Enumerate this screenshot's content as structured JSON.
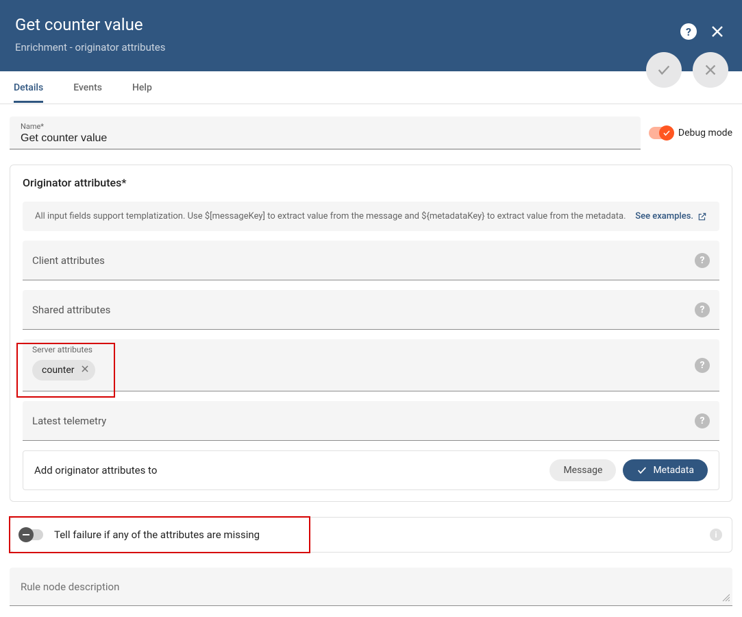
{
  "header": {
    "title": "Get counter value",
    "subtitle": "Enrichment - originator attributes"
  },
  "tabs": {
    "items": [
      "Details",
      "Events",
      "Help"
    ],
    "active": 0
  },
  "nameField": {
    "label": "Name*",
    "value": "Get counter value"
  },
  "debug": {
    "label": "Debug mode",
    "on": true
  },
  "panel": {
    "title": "Originator attributes*",
    "info": "All input fields support templatization. Use $[messageKey] to extract value from the message and ${metadataKey} to extract value from the metadata.",
    "seeExamples": "See examples.",
    "client": {
      "placeholder": "Client attributes"
    },
    "shared": {
      "placeholder": "Shared attributes"
    },
    "server": {
      "label": "Server attributes",
      "chips": [
        "counter"
      ]
    },
    "telemetry": {
      "placeholder": "Latest telemetry"
    },
    "dest": {
      "label": "Add originator attributes to",
      "options": {
        "message": "Message",
        "metadata": "Metadata"
      },
      "selected": "metadata"
    }
  },
  "failToggle": {
    "label": "Tell failure if any of the attributes are missing",
    "on": false
  },
  "description": {
    "placeholder": "Rule node description"
  }
}
